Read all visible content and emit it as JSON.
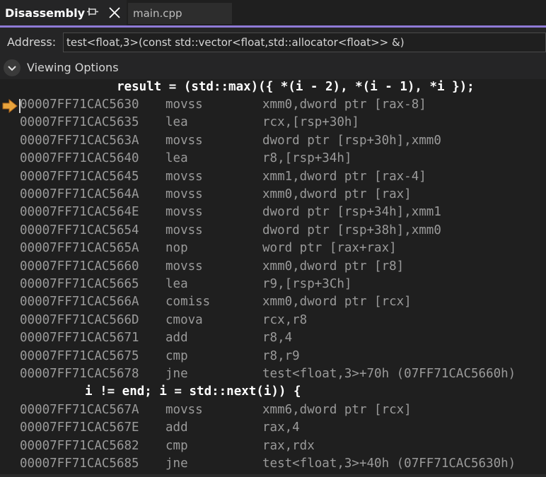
{
  "tabs": {
    "active_label": "Disassembly",
    "inactive_label": "main.cpp"
  },
  "address": {
    "label": "Address:",
    "value": "test<float,3>(const std::vector<float,std::allocator<float>> &)"
  },
  "viewing_options": {
    "label": "Viewing Options"
  },
  "code": {
    "source_line_1": "result = (std::max)({ *(i - 2), *(i - 1), *i });",
    "block1": [
      {
        "addr": "00007FF71CAC5630",
        "op": "movss",
        "args": "xmm0,dword ptr [rax-8]"
      },
      {
        "addr": "00007FF71CAC5635",
        "op": "lea",
        "args": "rcx,[rsp+30h]"
      },
      {
        "addr": "00007FF71CAC563A",
        "op": "movss",
        "args": "dword ptr [rsp+30h],xmm0"
      },
      {
        "addr": "00007FF71CAC5640",
        "op": "lea",
        "args": "r8,[rsp+34h]"
      },
      {
        "addr": "00007FF71CAC5645",
        "op": "movss",
        "args": "xmm1,dword ptr [rax-4]"
      },
      {
        "addr": "00007FF71CAC564A",
        "op": "movss",
        "args": "xmm0,dword ptr [rax]"
      },
      {
        "addr": "00007FF71CAC564E",
        "op": "movss",
        "args": "dword ptr [rsp+34h],xmm1"
      },
      {
        "addr": "00007FF71CAC5654",
        "op": "movss",
        "args": "dword ptr [rsp+38h],xmm0"
      },
      {
        "addr": "00007FF71CAC565A",
        "op": "nop",
        "args": "word ptr [rax+rax]"
      },
      {
        "addr": "00007FF71CAC5660",
        "op": "movss",
        "args": "xmm0,dword ptr [r8]"
      },
      {
        "addr": "00007FF71CAC5665",
        "op": "lea",
        "args": "r9,[rsp+3Ch]"
      },
      {
        "addr": "00007FF71CAC566A",
        "op": "comiss",
        "args": "xmm0,dword ptr [rcx]"
      },
      {
        "addr": "00007FF71CAC566D",
        "op": "cmova",
        "args": "rcx,r8"
      },
      {
        "addr": "00007FF71CAC5671",
        "op": "add",
        "args": "r8,4"
      },
      {
        "addr": "00007FF71CAC5675",
        "op": "cmp",
        "args": "r8,r9"
      },
      {
        "addr": "00007FF71CAC5678",
        "op": "jne",
        "args": "test<float,3>+70h (07FF71CAC5660h)"
      }
    ],
    "source_line_2": "i != end; i = std::next(i)) {",
    "block2": [
      {
        "addr": "00007FF71CAC567A",
        "op": "movss",
        "args": "xmm6,dword ptr [rcx]"
      },
      {
        "addr": "00007FF71CAC567E",
        "op": "add",
        "args": "rax,4"
      },
      {
        "addr": "00007FF71CAC5682",
        "op": "cmp",
        "args": "rax,rdx"
      },
      {
        "addr": "00007FF71CAC5685",
        "op": "jne",
        "args": "test<float,3>+40h (07FF71CAC5630h)"
      }
    ]
  },
  "colors": {
    "accent": "#8f7ad6",
    "marker": "#e8a33c",
    "background": "#1f1f1f"
  },
  "icons": {
    "pin": "pin-icon",
    "close": "close-icon",
    "chevron": "chevron-down-icon",
    "current_instruction": "instruction-pointer-arrow-icon"
  }
}
